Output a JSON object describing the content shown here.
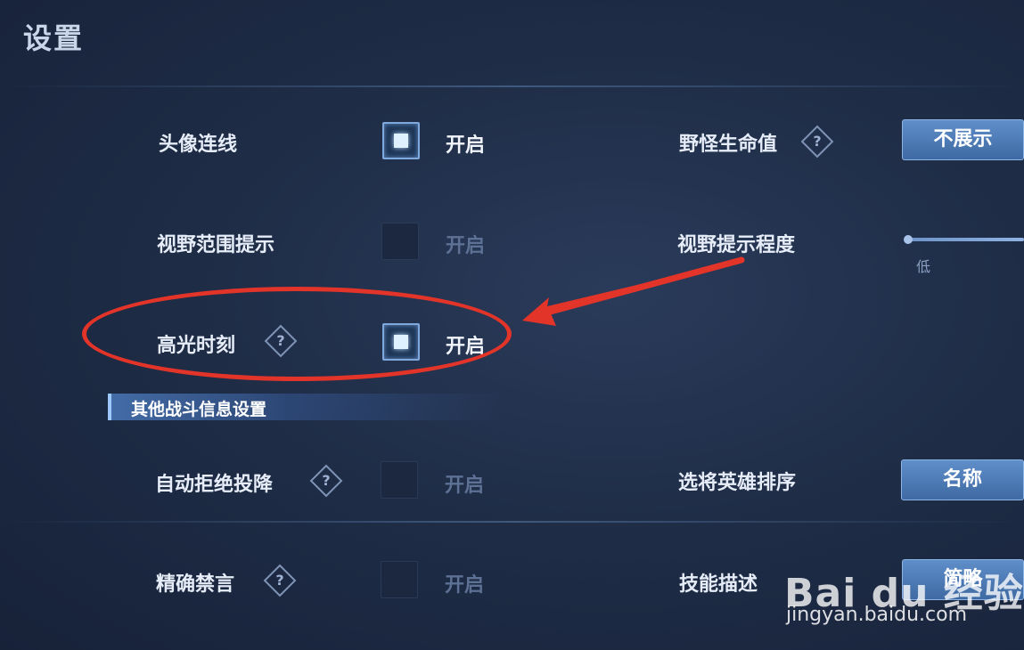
{
  "header": {
    "title": "设置"
  },
  "settings_left": [
    {
      "label": "头像连线",
      "checked": true,
      "state": "开启",
      "help": false
    },
    {
      "label": "视野范围提示",
      "checked": false,
      "state": "开启",
      "help": false
    },
    {
      "label": "高光时刻",
      "checked": true,
      "state": "开启",
      "help": true
    }
  ],
  "section": {
    "title": "其他战斗信息设置"
  },
  "settings_left_2": [
    {
      "label": "自动拒绝投降",
      "checked": false,
      "state": "开启",
      "help": true
    },
    {
      "label": "精确禁言",
      "checked": false,
      "state": "开启",
      "help": true
    }
  ],
  "settings_right": {
    "monster_hp": {
      "label": "野怪生命值",
      "value": "不展示"
    },
    "vision_hint": {
      "label": "视野提示程度",
      "low_label": "低"
    },
    "hero_sort": {
      "label": "选将英雄排序",
      "value": "名称"
    },
    "skill_desc": {
      "label": "技能描述",
      "value": "简略"
    }
  },
  "help_symbol": "?",
  "watermark": {
    "logo": "Bai du 经验",
    "url": "jingyan.baidu.com"
  },
  "colors": {
    "accent": "#5f8ec9",
    "annotation": "#e3342a",
    "background": "#1f2d47"
  }
}
